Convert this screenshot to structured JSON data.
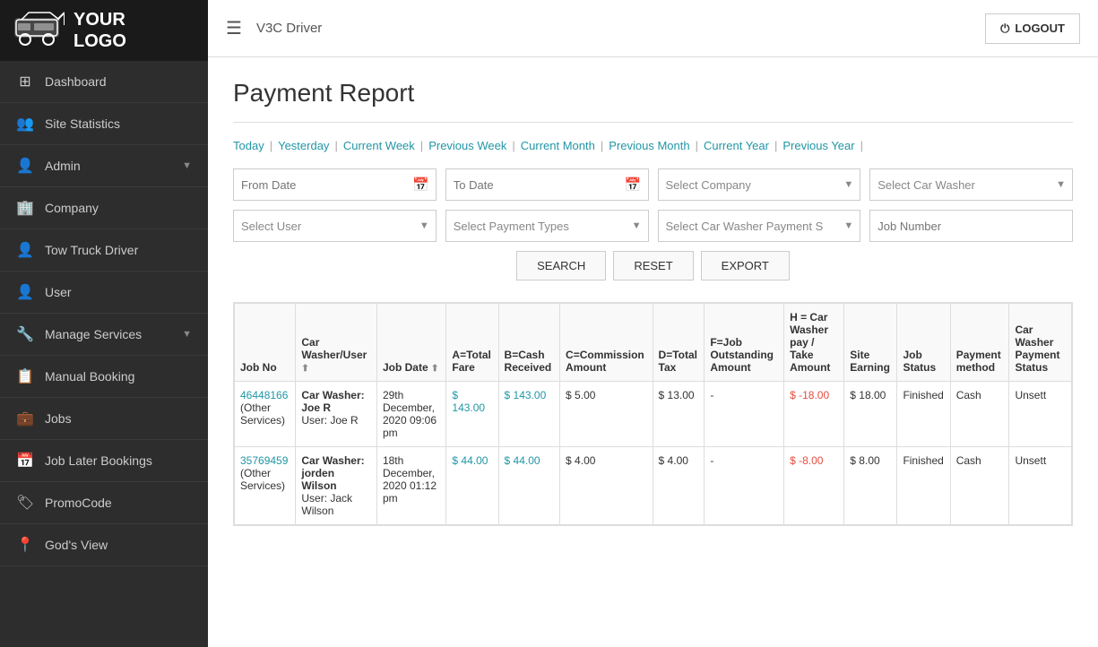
{
  "app": {
    "logo_text": "YOUR\nLOGO",
    "topbar_title": "V3C  Driver",
    "logout_label": "LOGOUT"
  },
  "sidebar": {
    "items": [
      {
        "id": "dashboard",
        "label": "Dashboard",
        "icon": "⊞"
      },
      {
        "id": "site-statistics",
        "label": "Site Statistics",
        "icon": "👥"
      },
      {
        "id": "admin",
        "label": "Admin",
        "icon": "👤",
        "arrow": true
      },
      {
        "id": "company",
        "label": "Company",
        "icon": "🏢"
      },
      {
        "id": "tow-truck-driver",
        "label": "Tow Truck Driver",
        "icon": "👤"
      },
      {
        "id": "user",
        "label": "User",
        "icon": "👤"
      },
      {
        "id": "manage-services",
        "label": "Manage Services",
        "icon": "🔧",
        "arrow": true
      },
      {
        "id": "manual-booking",
        "label": "Manual Booking",
        "icon": "📋"
      },
      {
        "id": "jobs",
        "label": "Jobs",
        "icon": "💼"
      },
      {
        "id": "job-later-bookings",
        "label": "Job Later Bookings",
        "icon": "📅"
      },
      {
        "id": "promo-code",
        "label": "PromoCode",
        "icon": "🏷"
      },
      {
        "id": "gods-view",
        "label": "God's View",
        "icon": "📍"
      }
    ]
  },
  "page": {
    "title": "Payment Report"
  },
  "date_filters": {
    "links": [
      "Today",
      "Yesterday",
      "Current Week",
      "Previous Week",
      "Current Month",
      "Previous Month",
      "Current Year",
      "Previous Year"
    ]
  },
  "filters": {
    "from_date_placeholder": "From Date",
    "to_date_placeholder": "To Date",
    "select_company_placeholder": "Select Company",
    "select_car_washer_placeholder": "Select Car Washer",
    "select_user_placeholder": "Select User",
    "select_payment_types_placeholder": "Select Payment Types",
    "select_car_washer_payment_placeholder": "Select Car Washer Payment S",
    "job_number_placeholder": "Job Number",
    "search_label": "SEARCH",
    "reset_label": "RESET",
    "export_label": "EXPORT"
  },
  "table": {
    "headers": [
      "Job No",
      "Car Washer/User ⬆",
      "Job Date ⬆",
      "A=Total Fare",
      "B=Cash Received",
      "C=Commission Amount",
      "D=Total Tax",
      "F=Job Outstanding Amount",
      "H = Car Washer pay / Take Amount",
      "Site Earning",
      "Job Status",
      "Payment method",
      "Car Washer Payment Status"
    ],
    "rows": [
      {
        "job_no": "46448166",
        "job_no_sub": "(Other Services)",
        "car_washer": "Car Washer: Joe R",
        "user": "User: Joe R",
        "job_date": "29th December, 2020 09:06 pm",
        "total_fare": "$ 143.00",
        "cash_received": "$ 143.00",
        "commission": "$ 5.00",
        "total_tax": "$ 13.00",
        "outstanding": "-",
        "h_amount": "$ -18.00",
        "site_earning": "$ 18.00",
        "job_status": "Finished",
        "payment_method": "Cash",
        "payment_status": "Unsett"
      },
      {
        "job_no": "35769459",
        "job_no_sub": "(Other Services)",
        "car_washer": "Car Washer: jorden Wilson",
        "user": "User: Jack Wilson",
        "job_date": "18th December, 2020 01:12 pm",
        "total_fare": "$ 44.00",
        "cash_received": "$ 44.00",
        "commission": "$ 4.00",
        "total_tax": "$ 4.00",
        "outstanding": "-",
        "h_amount": "$ -8.00",
        "site_earning": "$ 8.00",
        "job_status": "Finished",
        "payment_method": "Cash",
        "payment_status": "Unsett"
      }
    ]
  }
}
